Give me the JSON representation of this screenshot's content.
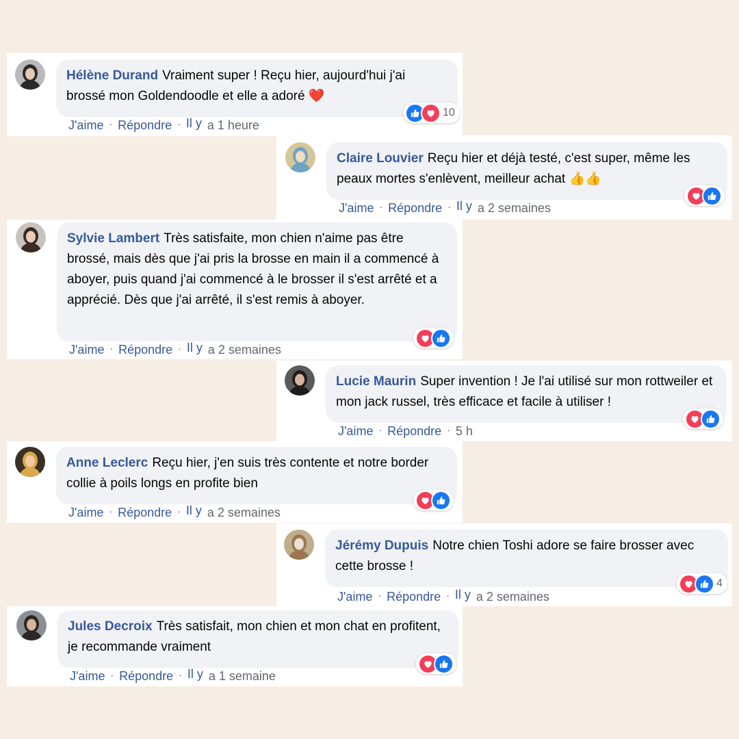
{
  "comments": [
    {
      "name": "Hélène Durand",
      "text": "Vraiment super ! Reçu hier, aujourd'hui j'ai brossé mon Goldendoodle et elle a adoré ❤️",
      "like": "J'aime",
      "reply": "Répondre",
      "il_y": "Il y",
      "time": "a 1 heure",
      "reactions": [
        "like",
        "love"
      ],
      "reaction_count": "10"
    },
    {
      "name": "Claire Louvier",
      "text": "Reçu hier et déjà testé, c'est super, même les peaux mortes s'enlèvent, meilleur achat 👍👍",
      "like": "J'aime",
      "reply": "Répondre",
      "il_y": "Il y",
      "time": "a 2 semaines",
      "reactions": [
        "love",
        "like"
      ],
      "reaction_count": ""
    },
    {
      "name": "Sylvie Lambert",
      "text": "Très satisfaite, mon chien n'aime pas être brossé, mais dès que j'ai pris la brosse en main il a commencé à aboyer, puis quand j'ai commencé à le brosser il s'est arrêté et a apprécié. Dès que j'ai arrêté, il s'est remis à aboyer.",
      "like": "J'aime",
      "reply": "Répondre",
      "il_y": "Il y",
      "time": "a 2 semaines",
      "reactions": [
        "love",
        "like"
      ],
      "reaction_count": ""
    },
    {
      "name": "Lucie Maurin",
      "text": "Super invention ! Je l'ai utilisé sur mon rottweiler et mon jack russel, très efficace et facile à utiliser !",
      "like": "J'aime",
      "reply": "Répondre",
      "il_y": "",
      "time": "5 h",
      "reactions": [
        "love",
        "like"
      ],
      "reaction_count": ""
    },
    {
      "name": "Anne Leclerc",
      "text": "Reçu hier, j'en suis très contente et notre border collie à poils longs en profite bien",
      "like": "J'aime",
      "reply": "Répondre",
      "il_y": "Il y",
      "time": "a 2 semaines",
      "reactions": [
        "love",
        "like"
      ],
      "reaction_count": ""
    },
    {
      "name": "Jérémy Dupuis",
      "text": "Notre chien Toshi adore se faire brosser avec cette brosse !",
      "like": "J'aime",
      "reply": "Répondre",
      "il_y": "Il y",
      "time": "a 2 semaines",
      "reactions": [
        "love",
        "like"
      ],
      "reaction_count": "4"
    },
    {
      "name": "Jules Decroix",
      "text": "Très satisfait, mon chien et mon chat en profitent, je recommande vraiment",
      "like": "J'aime",
      "reply": "Répondre",
      "il_y": "Il y",
      "time": "a 1 semaine",
      "reactions": [
        "love",
        "like"
      ],
      "reaction_count": ""
    }
  ],
  "colors": {
    "background": "#f6ede4",
    "name": "#385898",
    "bubble": "#f0f2f5",
    "like": "#1877f2",
    "love": "#f33e58"
  }
}
